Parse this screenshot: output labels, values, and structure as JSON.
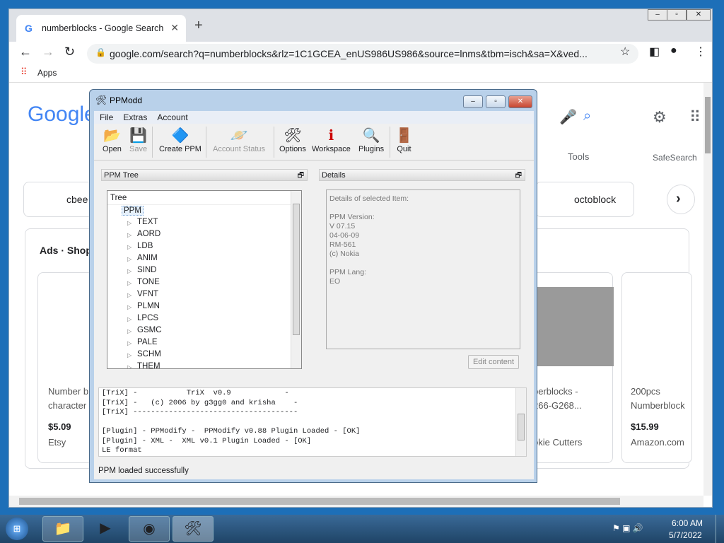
{
  "browser": {
    "tab_title": "numberblocks - Google Search",
    "url": "google.com/search?q=numberblocks&rlz=1C1GCEA_enUS986US986&source=lnms&tbm=isch&sa=X&ved...",
    "bookmarks": [
      "Apps"
    ]
  },
  "google": {
    "logo": "Google",
    "tools": "Tools",
    "safesearch": "SafeSearch",
    "chips": [
      "cbee",
      "octoblock"
    ],
    "ads_title": "Ads · Shop",
    "products": [
      {
        "title1": "Number b",
        "title2": "character",
        "price": "$5.09",
        "seller": "Etsy"
      },
      {
        "title1": "berblocks -",
        "title2": "266-G268...",
        "price": "",
        "seller": "okie Cutters"
      },
      {
        "title1": "200pcs",
        "title2": "Numberblock",
        "price": "$15.99",
        "seller": "Amazon.com"
      }
    ]
  },
  "ppmodd": {
    "title": "PPModd",
    "menu": [
      "File",
      "Extras",
      "Account"
    ],
    "toolbar": [
      {
        "label": "Open",
        "icon": "folder-icon",
        "enabled": true
      },
      {
        "label": "Save",
        "icon": "save-icon",
        "enabled": false
      },
      {
        "label": "Create PPM",
        "icon": "create-icon",
        "enabled": true
      },
      {
        "label": "Account Status",
        "icon": "account-icon",
        "enabled": false
      },
      {
        "label": "Options",
        "icon": "tools-icon",
        "enabled": true
      },
      {
        "label": "Workspace",
        "icon": "workspace-icon",
        "enabled": true
      },
      {
        "label": "Plugins",
        "icon": "magnifier-icon",
        "enabled": true
      },
      {
        "label": "Quit",
        "icon": "exit-icon",
        "enabled": true
      }
    ],
    "tree_pane": "PPM Tree",
    "tree_header": "Tree",
    "tree_root": "PPM",
    "tree_items": [
      "TEXT",
      "AORD",
      "LDB",
      "ANIM",
      "SIND",
      "TONE",
      "VFNT",
      "PLMN",
      "LPCS",
      "GSMC",
      "PALE",
      "SCHM",
      "THEM"
    ],
    "details_pane": "Details",
    "details": [
      "Details of selected Item:",
      "",
      "PPM Version:",
      "V 07.15",
      "04-06-09",
      "RM-561",
      "(c) Nokia",
      "",
      "PPM Lang:",
      "EO"
    ],
    "edit_button": "Edit content",
    "log": [
      "[TriX] -           TriX  v0.9            -",
      "[TriX] -   (c) 2006 by g3gg0 and krisha    -",
      "[TriX] -------------------------------------",
      "",
      "[Plugin] - PPModify -  PPModify v0.88 Plugin Loaded - [OK]",
      "[Plugin] - XML -  XML v0.1 Plugin Loaded - [OK]",
      "LE format"
    ],
    "status": "PPM loaded successfully"
  },
  "taskbar": {
    "time": "6:00 AM",
    "date": "5/7/2022"
  }
}
